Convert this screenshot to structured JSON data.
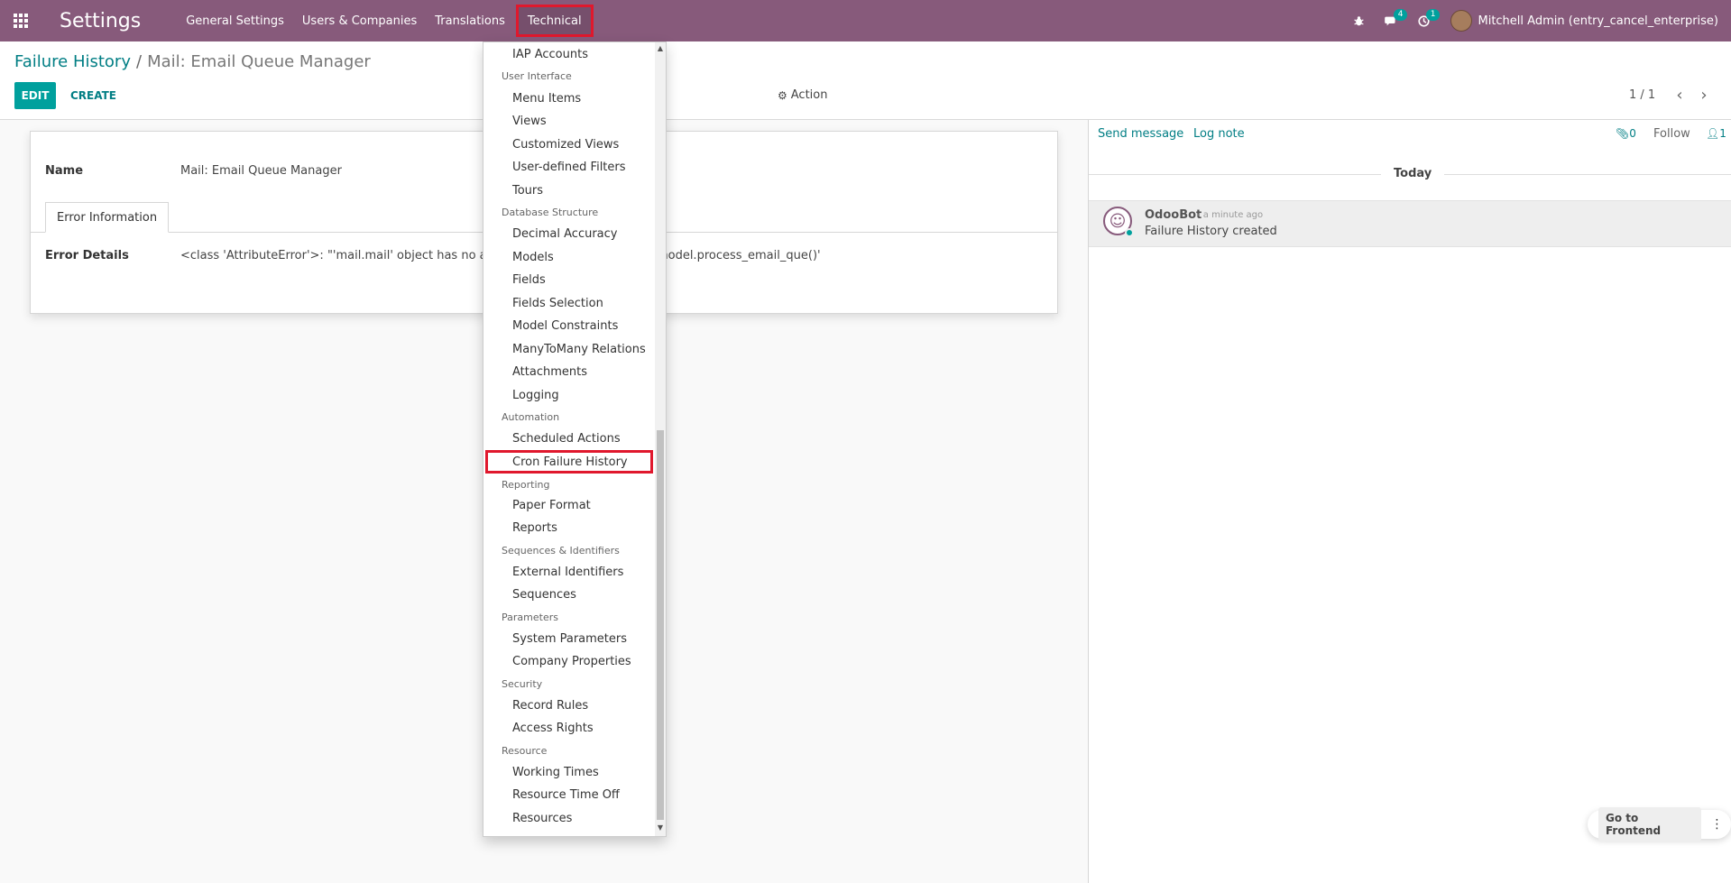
{
  "navbar": {
    "brand": "Settings",
    "menu": [
      "General Settings",
      "Users & Companies",
      "Translations",
      "Technical"
    ],
    "messages_badge": "4",
    "activities_badge": "1",
    "user_name": "Mitchell Admin (entry_cancel_enterprise)"
  },
  "control_panel": {
    "breadcrumb_parent": "Failure History",
    "breadcrumb_separator": "/",
    "breadcrumb_current": "Mail: Email Queue Manager",
    "edit_label": "EDIT",
    "create_label": "CREATE",
    "action_label": "Action",
    "pager": "1 / 1"
  },
  "form": {
    "name_label": "Name",
    "name_value": "Mail: Email Queue Manager",
    "tab_label": "Error Information",
    "error_label": "Error Details",
    "error_value_left": "<class 'AttributeError'>: \"'mail.mail' object has no attribute '",
    "error_value_right": "g 'model.process_email_que()'"
  },
  "chatter": {
    "send_message": "Send message",
    "log_note": "Log note",
    "attachments_count": "0",
    "follow_label": "Follow",
    "followers_count": "1",
    "today_label": "Today",
    "message": {
      "author": "OdooBot",
      "date": "- a minute ago",
      "body": "Failure History created"
    }
  },
  "dropdown": {
    "items": [
      {
        "type": "item",
        "label": "IAP Accounts"
      },
      {
        "type": "header",
        "label": "User Interface"
      },
      {
        "type": "item",
        "label": "Menu Items"
      },
      {
        "type": "item",
        "label": "Views"
      },
      {
        "type": "item",
        "label": "Customized Views"
      },
      {
        "type": "item",
        "label": "User-defined Filters"
      },
      {
        "type": "item",
        "label": "Tours"
      },
      {
        "type": "header",
        "label": "Database Structure"
      },
      {
        "type": "item",
        "label": "Decimal Accuracy"
      },
      {
        "type": "item",
        "label": "Models"
      },
      {
        "type": "item",
        "label": "Fields"
      },
      {
        "type": "item",
        "label": "Fields Selection"
      },
      {
        "type": "item",
        "label": "Model Constraints"
      },
      {
        "type": "item",
        "label": "ManyToMany Relations"
      },
      {
        "type": "item",
        "label": "Attachments"
      },
      {
        "type": "item",
        "label": "Logging"
      },
      {
        "type": "header",
        "label": "Automation"
      },
      {
        "type": "item",
        "label": "Scheduled Actions"
      },
      {
        "type": "item",
        "label": "Cron Failure History"
      },
      {
        "type": "header",
        "label": "Reporting"
      },
      {
        "type": "item",
        "label": "Paper Format"
      },
      {
        "type": "item",
        "label": "Reports"
      },
      {
        "type": "header",
        "label": "Sequences & Identifiers"
      },
      {
        "type": "item",
        "label": "External Identifiers"
      },
      {
        "type": "item",
        "label": "Sequences"
      },
      {
        "type": "header",
        "label": "Parameters"
      },
      {
        "type": "item",
        "label": "System Parameters"
      },
      {
        "type": "item",
        "label": "Company Properties"
      },
      {
        "type": "header",
        "label": "Security"
      },
      {
        "type": "item",
        "label": "Record Rules"
      },
      {
        "type": "item",
        "label": "Access Rights"
      },
      {
        "type": "header",
        "label": "Resource"
      },
      {
        "type": "item",
        "label": "Working Times"
      },
      {
        "type": "item",
        "label": "Resource Time Off"
      },
      {
        "type": "item",
        "label": "Resources"
      }
    ]
  },
  "frontend": {
    "label": "Go to Frontend"
  },
  "colors": {
    "navbar": "#875a7b",
    "primary": "#00a09d",
    "link": "#017e84",
    "highlight": "#e0182d"
  }
}
